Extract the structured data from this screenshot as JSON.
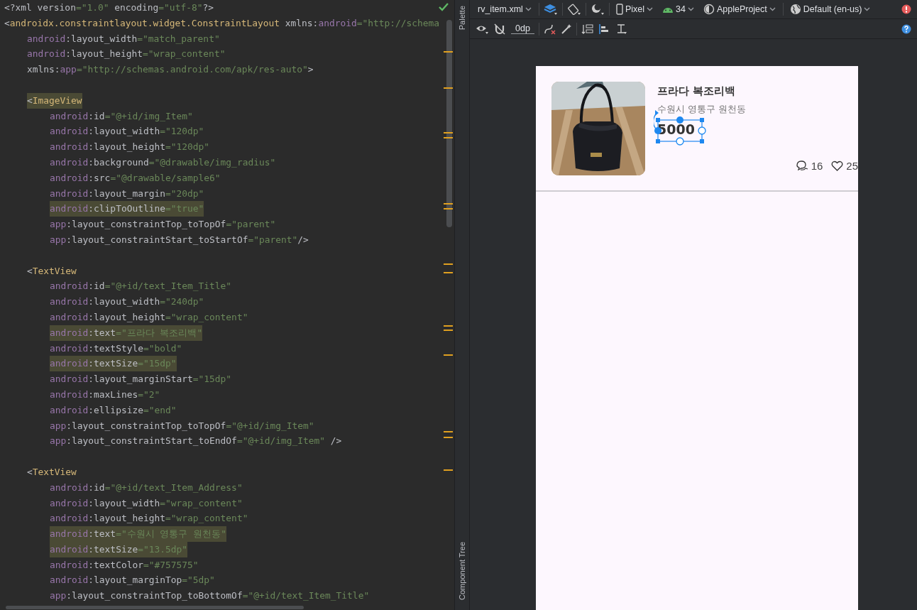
{
  "editor": {
    "prolog": {
      "highlighted": false,
      "segments": [
        {
          "kind": "punct",
          "text": "<?xml version"
        },
        {
          "kind": "value",
          "text": "=\"1.0\""
        },
        {
          "kind": "punct",
          "text": " encoding"
        },
        {
          "kind": "value",
          "text": "=\"utf-8\""
        },
        {
          "kind": "punct",
          "text": "?>"
        }
      ]
    },
    "root": {
      "open": {
        "highlighted": false,
        "segments": [
          {
            "kind": "punct",
            "text": "<"
          },
          {
            "kind": "tag",
            "text": "androidx.constraintlayout.widget.ConstraintLayout"
          },
          {
            "kind": "punct",
            "text": " xmlns:"
          },
          {
            "kind": "ns",
            "text": "android"
          },
          {
            "kind": "value",
            "text": "=\"http://schema"
          }
        ]
      },
      "attributes": [
        {
          "highlighted": false,
          "segments": [
            {
              "kind": "ns",
              "text": "android"
            },
            {
              "kind": "punct",
              "text": ":layout_width"
            },
            {
              "kind": "value",
              "text": "=\"match_parent\""
            }
          ]
        },
        {
          "highlighted": false,
          "segments": [
            {
              "kind": "ns",
              "text": "android"
            },
            {
              "kind": "punct",
              "text": ":layout_height"
            },
            {
              "kind": "value",
              "text": "=\"wrap_content\""
            }
          ]
        },
        {
          "highlighted": false,
          "segments": [
            {
              "kind": "punct",
              "text": "xmlns:"
            },
            {
              "kind": "ns",
              "text": "app"
            },
            {
              "kind": "value",
              "text": "=\"http://schemas.android.com/apk/res-auto\""
            },
            {
              "kind": "punct",
              "text": ">"
            }
          ]
        }
      ]
    },
    "elements": [
      {
        "open": {
          "highlighted": true,
          "segments": [
            {
              "kind": "punct",
              "text": "<"
            },
            {
              "kind": "tag",
              "text": "ImageView"
            }
          ]
        },
        "attributes": [
          {
            "highlighted": false,
            "segments": [
              {
                "kind": "ns",
                "text": "android"
              },
              {
                "kind": "punct",
                "text": ":id"
              },
              {
                "kind": "value",
                "text": "=\"@+id/img_Item\""
              }
            ]
          },
          {
            "highlighted": false,
            "segments": [
              {
                "kind": "ns",
                "text": "android"
              },
              {
                "kind": "punct",
                "text": ":layout_width"
              },
              {
                "kind": "value",
                "text": "=\"120dp\""
              }
            ]
          },
          {
            "highlighted": false,
            "segments": [
              {
                "kind": "ns",
                "text": "android"
              },
              {
                "kind": "punct",
                "text": ":layout_height"
              },
              {
                "kind": "value",
                "text": "=\"120dp\""
              }
            ]
          },
          {
            "highlighted": false,
            "segments": [
              {
                "kind": "ns",
                "text": "android"
              },
              {
                "kind": "punct",
                "text": ":background"
              },
              {
                "kind": "value",
                "text": "=\"@drawable/img_radius\""
              }
            ]
          },
          {
            "highlighted": false,
            "segments": [
              {
                "kind": "ns",
                "text": "android"
              },
              {
                "kind": "punct",
                "text": ":src"
              },
              {
                "kind": "value",
                "text": "=\"@drawable/sample6\""
              }
            ]
          },
          {
            "highlighted": false,
            "segments": [
              {
                "kind": "ns",
                "text": "android"
              },
              {
                "kind": "punct",
                "text": ":layout_margin"
              },
              {
                "kind": "value",
                "text": "=\"20dp\""
              }
            ]
          },
          {
            "highlighted": true,
            "segments": [
              {
                "kind": "ns",
                "text": "android"
              },
              {
                "kind": "punct",
                "text": ":clipToOutline"
              },
              {
                "kind": "value",
                "text": "=\"true\""
              }
            ]
          },
          {
            "highlighted": false,
            "segments": [
              {
                "kind": "ns",
                "text": "app"
              },
              {
                "kind": "punct",
                "text": ":layout_constraintTop_toTopOf"
              },
              {
                "kind": "value",
                "text": "=\"parent\""
              }
            ]
          },
          {
            "highlighted": false,
            "segments": [
              {
                "kind": "ns",
                "text": "app"
              },
              {
                "kind": "punct",
                "text": ":layout_constraintStart_toStartOf"
              },
              {
                "kind": "value",
                "text": "=\"parent\""
              },
              {
                "kind": "punct",
                "text": "/>"
              }
            ]
          }
        ]
      },
      {
        "open": {
          "highlighted": false,
          "segments": [
            {
              "kind": "punct",
              "text": "<"
            },
            {
              "kind": "tag",
              "text": "TextView"
            }
          ]
        },
        "attributes": [
          {
            "highlighted": false,
            "segments": [
              {
                "kind": "ns",
                "text": "android"
              },
              {
                "kind": "punct",
                "text": ":id"
              },
              {
                "kind": "value",
                "text": "=\"@+id/text_Item_Title\""
              }
            ]
          },
          {
            "highlighted": false,
            "segments": [
              {
                "kind": "ns",
                "text": "android"
              },
              {
                "kind": "punct",
                "text": ":layout_width"
              },
              {
                "kind": "value",
                "text": "=\"240dp\""
              }
            ]
          },
          {
            "highlighted": false,
            "segments": [
              {
                "kind": "ns",
                "text": "android"
              },
              {
                "kind": "punct",
                "text": ":layout_height"
              },
              {
                "kind": "value",
                "text": "=\"wrap_content\""
              }
            ]
          },
          {
            "highlighted": true,
            "segments": [
              {
                "kind": "ns",
                "text": "android"
              },
              {
                "kind": "punct",
                "text": ":text"
              },
              {
                "kind": "value",
                "text": "=\"프라다 복조리백\""
              }
            ]
          },
          {
            "highlighted": false,
            "segments": [
              {
                "kind": "ns",
                "text": "android"
              },
              {
                "kind": "punct",
                "text": ":textStyle"
              },
              {
                "kind": "value",
                "text": "=\"bold\""
              }
            ]
          },
          {
            "highlighted": true,
            "segments": [
              {
                "kind": "ns",
                "text": "android"
              },
              {
                "kind": "punct",
                "text": ":textSize"
              },
              {
                "kind": "value",
                "text": "=\"15dp\""
              }
            ]
          },
          {
            "highlighted": false,
            "segments": [
              {
                "kind": "ns",
                "text": "android"
              },
              {
                "kind": "punct",
                "text": ":layout_marginStart"
              },
              {
                "kind": "value",
                "text": "=\"15dp\""
              }
            ]
          },
          {
            "highlighted": false,
            "segments": [
              {
                "kind": "ns",
                "text": "android"
              },
              {
                "kind": "punct",
                "text": ":maxLines"
              },
              {
                "kind": "value",
                "text": "=\"2\""
              }
            ]
          },
          {
            "highlighted": false,
            "segments": [
              {
                "kind": "ns",
                "text": "android"
              },
              {
                "kind": "punct",
                "text": ":ellipsize"
              },
              {
                "kind": "value",
                "text": "=\"end\""
              }
            ]
          },
          {
            "highlighted": false,
            "segments": [
              {
                "kind": "ns",
                "text": "app"
              },
              {
                "kind": "punct",
                "text": ":layout_constraintTop_toTopOf"
              },
              {
                "kind": "value",
                "text": "=\"@+id/img_Item\""
              }
            ]
          },
          {
            "highlighted": false,
            "segments": [
              {
                "kind": "ns",
                "text": "app"
              },
              {
                "kind": "punct",
                "text": ":layout_constraintStart_toEndOf"
              },
              {
                "kind": "value",
                "text": "=\"@+id/img_Item\""
              },
              {
                "kind": "punct",
                "text": " />"
              }
            ]
          }
        ]
      },
      {
        "open": {
          "highlighted": false,
          "segments": [
            {
              "kind": "punct",
              "text": "<"
            },
            {
              "kind": "tag",
              "text": "TextView"
            }
          ]
        },
        "attributes": [
          {
            "highlighted": false,
            "segments": [
              {
                "kind": "ns",
                "text": "android"
              },
              {
                "kind": "punct",
                "text": ":id"
              },
              {
                "kind": "value",
                "text": "=\"@+id/text_Item_Address\""
              }
            ]
          },
          {
            "highlighted": false,
            "segments": [
              {
                "kind": "ns",
                "text": "android"
              },
              {
                "kind": "punct",
                "text": ":layout_width"
              },
              {
                "kind": "value",
                "text": "=\"wrap_content\""
              }
            ]
          },
          {
            "highlighted": false,
            "segments": [
              {
                "kind": "ns",
                "text": "android"
              },
              {
                "kind": "punct",
                "text": ":layout_height"
              },
              {
                "kind": "value",
                "text": "=\"wrap_content\""
              }
            ]
          },
          {
            "highlighted": true,
            "segments": [
              {
                "kind": "ns",
                "text": "android"
              },
              {
                "kind": "punct",
                "text": ":text"
              },
              {
                "kind": "value",
                "text": "=\"수원시 영통구 원천동\""
              }
            ]
          },
          {
            "highlighted": true,
            "segments": [
              {
                "kind": "ns",
                "text": "android"
              },
              {
                "kind": "punct",
                "text": ":textSize"
              },
              {
                "kind": "value",
                "text": "=\"13.5dp\""
              }
            ]
          },
          {
            "highlighted": false,
            "segments": [
              {
                "kind": "ns",
                "text": "android"
              },
              {
                "kind": "punct",
                "text": ":textColor"
              },
              {
                "kind": "value",
                "text": "=\"#757575\""
              }
            ]
          },
          {
            "highlighted": false,
            "segments": [
              {
                "kind": "ns",
                "text": "android"
              },
              {
                "kind": "punct",
                "text": ":layout_marginTop"
              },
              {
                "kind": "value",
                "text": "=\"5dp\""
              }
            ]
          },
          {
            "highlighted": false,
            "segments": [
              {
                "kind": "ns",
                "text": "app"
              },
              {
                "kind": "punct",
                "text": ":layout_constraintTop_toBottomOf"
              },
              {
                "kind": "value",
                "text": "=\"@+id/text_Item_Title\""
              }
            ]
          }
        ]
      }
    ]
  },
  "side_tabs": [
    "Palette",
    "Component Tree"
  ],
  "toolbar": {
    "file": "rv_item.xml",
    "device": "Pixel",
    "api": "34",
    "theme": "AppleProject",
    "locale": "Default (en-us)",
    "margin": "0dp"
  },
  "preview": {
    "title": "프라다 복조리백",
    "address": "수원시 영통구 원천동",
    "price": "5000",
    "comments": "16",
    "likes": "25"
  }
}
